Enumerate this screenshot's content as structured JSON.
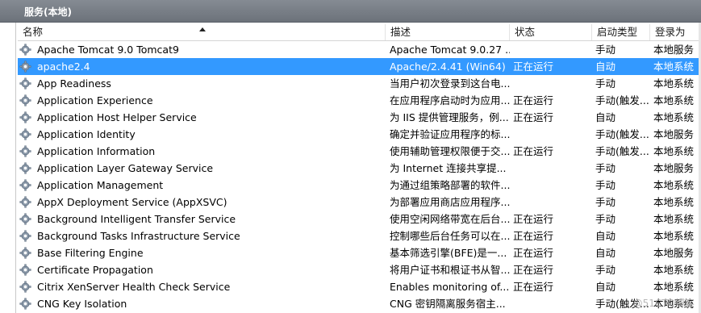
{
  "window": {
    "title": "服务(本地)"
  },
  "columns": {
    "name": "名称",
    "description": "描述",
    "status": "状态",
    "startup_type": "启动类型",
    "log_on_as": "登录为"
  },
  "services": [
    {
      "name": "Apache Tomcat 9.0 Tomcat9",
      "description": "Apache Tomcat 9.0.27 ...",
      "status": "",
      "startup_type": "手动",
      "log_on_as": "本地服务"
    },
    {
      "name": "apache2.4",
      "description": "Apache/2.4.41 (Win64)",
      "status": "正在运行",
      "startup_type": "自动",
      "log_on_as": "本地系统"
    },
    {
      "name": "App Readiness",
      "description": "当用户初次登录到这台电...",
      "status": "",
      "startup_type": "手动",
      "log_on_as": "本地系统"
    },
    {
      "name": "Application Experience",
      "description": "在应用程序启动时为应用...",
      "status": "正在运行",
      "startup_type": "手动(触发...",
      "log_on_as": "本地系统"
    },
    {
      "name": "Application Host Helper Service",
      "description": "为 IIS 提供管理服务，例...",
      "status": "正在运行",
      "startup_type": "自动",
      "log_on_as": "本地系统"
    },
    {
      "name": "Application Identity",
      "description": "确定并验证应用程序的标...",
      "status": "",
      "startup_type": "手动(触发...",
      "log_on_as": "本地服务"
    },
    {
      "name": "Application Information",
      "description": "使用辅助管理权限便于交...",
      "status": "正在运行",
      "startup_type": "手动(触发...",
      "log_on_as": "本地系统"
    },
    {
      "name": "Application Layer Gateway Service",
      "description": "为 Internet 连接共享提...",
      "status": "",
      "startup_type": "手动",
      "log_on_as": "本地服务"
    },
    {
      "name": "Application Management",
      "description": "为通过组策略部署的软件...",
      "status": "",
      "startup_type": "手动",
      "log_on_as": "本地系统"
    },
    {
      "name": "AppX Deployment Service (AppXSVC)",
      "description": "为部署应用商店应用程序...",
      "status": "",
      "startup_type": "手动",
      "log_on_as": "本地系统"
    },
    {
      "name": "Background Intelligent Transfer Service",
      "description": "使用空闲网络带宽在后台...",
      "status": "正在运行",
      "startup_type": "手动",
      "log_on_as": "本地系统"
    },
    {
      "name": "Background Tasks Infrastructure Service",
      "description": "控制哪些后台任务可以在...",
      "status": "正在运行",
      "startup_type": "自动",
      "log_on_as": "本地系统"
    },
    {
      "name": "Base Filtering Engine",
      "description": "基本筛选引擎(BFE)是一...",
      "status": "正在运行",
      "startup_type": "自动",
      "log_on_as": "本地服务"
    },
    {
      "name": "Certificate Propagation",
      "description": "将用户证书和根证书从智...",
      "status": "正在运行",
      "startup_type": "手动",
      "log_on_as": "本地系统"
    },
    {
      "name": "Citrix XenServer Health Check Service",
      "description": "Enables monitoring of...",
      "status": "正在运行",
      "startup_type": "自动",
      "log_on_as": "本地系统"
    },
    {
      "name": "CNG Key Isolation",
      "description": "CNG 密钥隔离服务宿主...",
      "status": "",
      "startup_type": "手动(触发...",
      "log_on_as": "本地系统"
    }
  ],
  "selected_index": 1,
  "watermark": "@51CTO博客",
  "colors": {
    "selection": "#3399ff",
    "titlebar": "#7a8088"
  },
  "icons": {
    "service": "gear-icon",
    "sort": "sort-ascending-icon"
  }
}
